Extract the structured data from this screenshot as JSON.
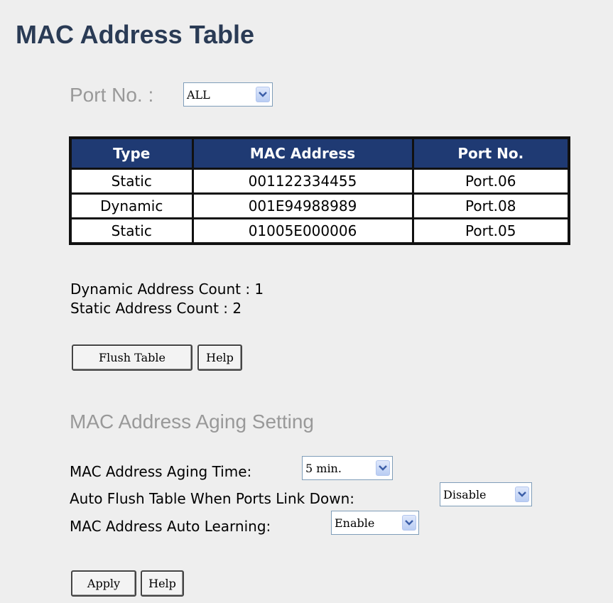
{
  "page": {
    "title": "MAC Address Table"
  },
  "port_filter": {
    "label": "Port No. :",
    "selected": "ALL"
  },
  "mac_table": {
    "headers": [
      "Type",
      "MAC Address",
      "Port No."
    ],
    "rows": [
      [
        "Static",
        "001122334455",
        "Port.06"
      ],
      [
        "Dynamic",
        "001E94988989",
        "Port.08"
      ],
      [
        "Static",
        "01005E000006",
        "Port.05"
      ]
    ]
  },
  "counts": {
    "dynamic": "Dynamic Address Count : 1",
    "static": "Static Address Count : 2"
  },
  "table_buttons": {
    "flush": "Flush Table",
    "help": "Help"
  },
  "aging": {
    "heading": "MAC Address Aging Setting",
    "aging_time_label": "MAC Address Aging Time:",
    "aging_time_value": "5 min.",
    "auto_flush_label": "Auto Flush Table When Ports Link Down:",
    "auto_flush_value": "Disable",
    "auto_learning_label": "MAC Address Auto Learning:",
    "auto_learning_value": "Enable"
  },
  "aging_buttons": {
    "apply": "Apply",
    "help": "Help"
  },
  "icons": {
    "dropdown_arrow": "chevron-down-icon"
  },
  "colors": {
    "header_bg": "#1f3a73",
    "title": "#2a3b55",
    "section_label": "#999999",
    "panel_bg": "#eeeeee"
  }
}
